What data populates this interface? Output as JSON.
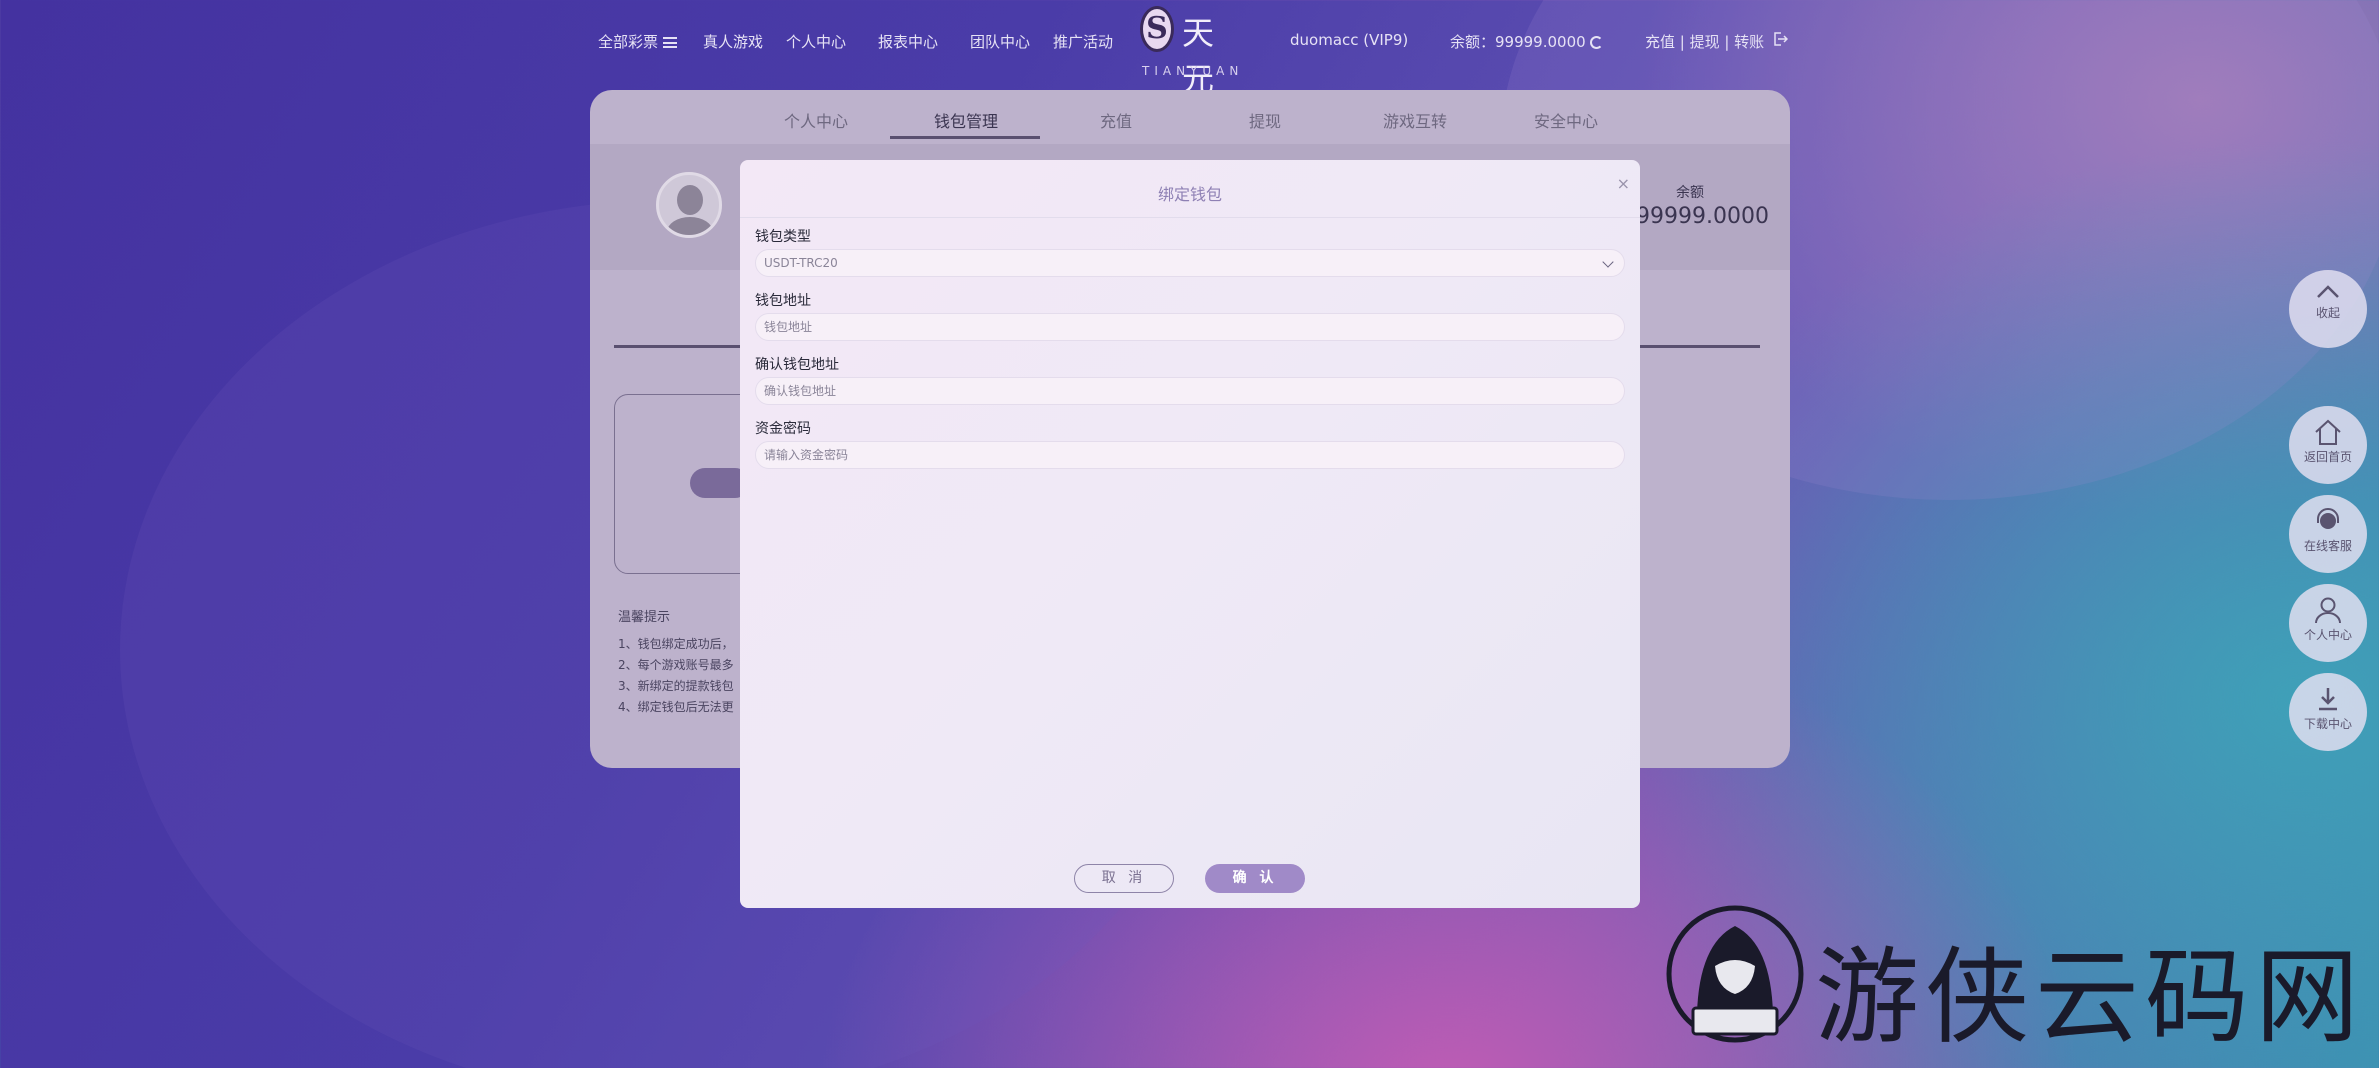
{
  "topnav": {
    "all_lottery": "全部彩票",
    "live_games": "真人游戏",
    "personal_center": "个人中心",
    "reports": "报表中心",
    "team_center": "团队中心",
    "promo": "推广活动",
    "username": "duomacc (VIP9)",
    "balance": "余额：99999.0000",
    "account_links": "充值 | 提现 | 转账"
  },
  "logo": {
    "symbol": "S",
    "chinese": "天元",
    "english": "TIANYUAN"
  },
  "panel": {
    "tabs": [
      "个人中心",
      "钱包管理",
      "充值",
      "提现",
      "游戏互转",
      "安全中心"
    ],
    "active_tab": "钱包管理",
    "balance_label": "余额",
    "balance_value": "99999.0000",
    "tips_title": "温馨提示",
    "tips": [
      "1、钱包绑定成功后，",
      "2、每个游戏账号最多",
      "3、新绑定的提款钱包",
      "4、绑定钱包后无法更"
    ]
  },
  "modal": {
    "title": "绑定钱包",
    "close": "×",
    "wallet_type_label": "钱包类型",
    "wallet_type_value": "USDT-TRC20",
    "wallet_address_label": "钱包地址",
    "wallet_address_placeholder": "钱包地址",
    "confirm_address_label": "确认钱包地址",
    "confirm_address_placeholder": "确认钱包地址",
    "fund_password_label": "资金密码",
    "fund_password_placeholder": "请输入资金密码",
    "cancel_label": "取 消",
    "confirm_label": "确 认"
  },
  "sidebar": {
    "collapse": "收起",
    "home": "返回首页",
    "support": "在线客服",
    "personal": "个人中心",
    "download": "下载中心"
  },
  "watermark": {
    "text": "游侠云码网"
  },
  "colors": {
    "accent": "#a08ac8",
    "modal_title": "#8e80b4"
  }
}
